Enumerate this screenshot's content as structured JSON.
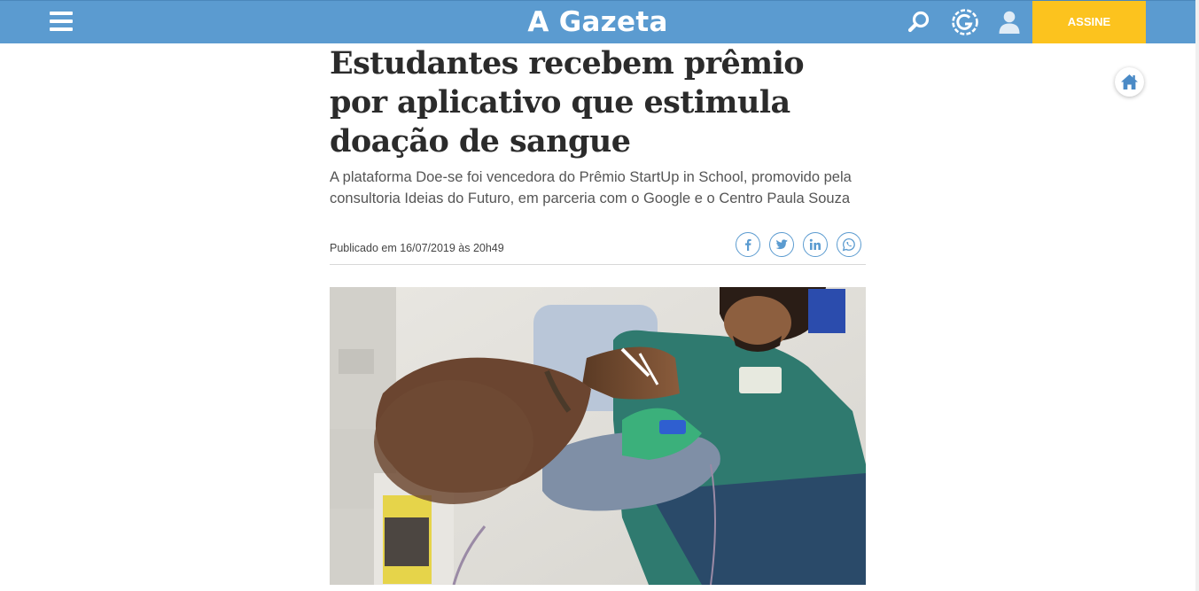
{
  "header": {
    "logo": "A Gazeta",
    "subscribe_label": "ASSINE",
    "icons": [
      "menu-icon",
      "search-icon",
      "g-icon",
      "user-icon"
    ]
  },
  "article": {
    "headline": "Estudantes recebem prêmio por aplicativo que estimula doação de sangue",
    "subtitle": "A plataforma Doe-se foi vencedora do Prêmio StartUp in School, promovido pela consultoria Ideias do Futuro, em parceria com o Google e o Centro Paula Souza",
    "published_label": "Publicado em",
    "published_date": "16/07/2019 às 20h49",
    "share_icons": [
      "facebook-icon",
      "twitter-icon",
      "linkedin-icon",
      "whatsapp-icon"
    ]
  },
  "floating": {
    "icon": "home-icon"
  },
  "colors": {
    "header_bg": "#5b9bd0",
    "subscribe_bg": "#fcc31e",
    "headline_text": "#2b2b2b",
    "share_accent": "#5b9bd0"
  }
}
